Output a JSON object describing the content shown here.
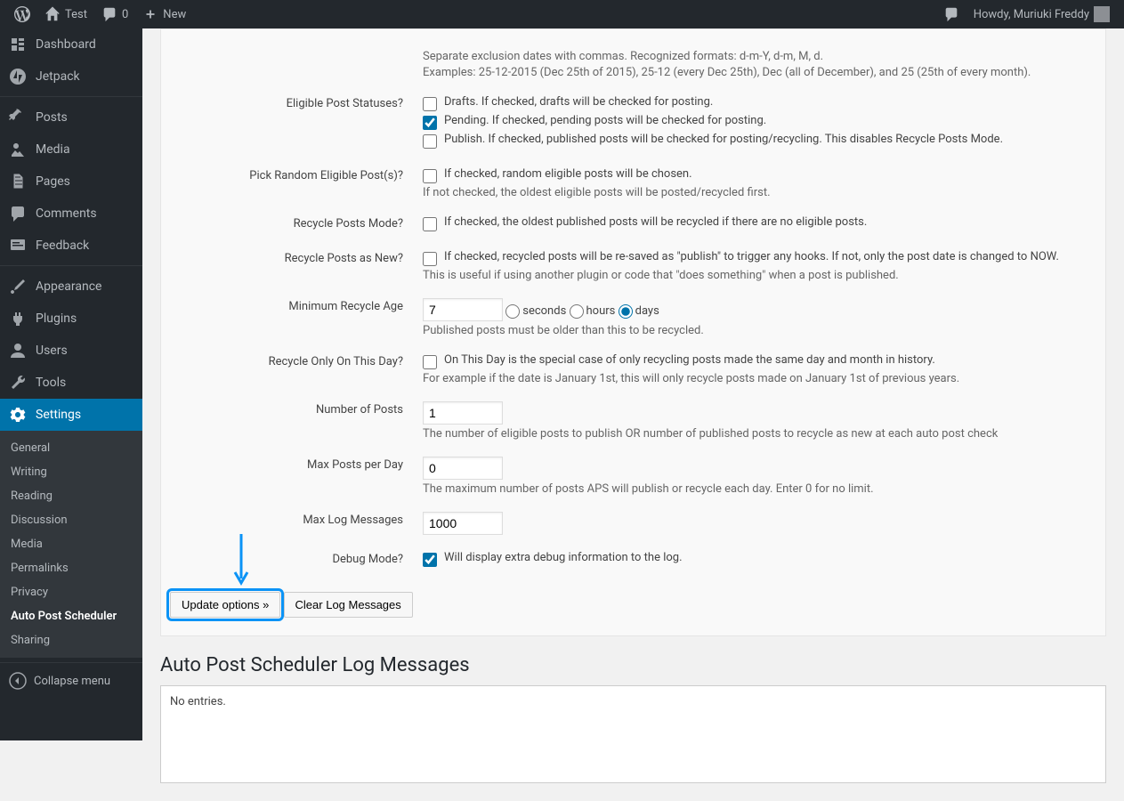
{
  "adminbar": {
    "site_name": "Test",
    "comments_count": "0",
    "new_label": "New",
    "howdy": "Howdy, Muriuki Freddy"
  },
  "sidebar": {
    "dashboard": "Dashboard",
    "jetpack": "Jetpack",
    "posts": "Posts",
    "media": "Media",
    "pages": "Pages",
    "comments": "Comments",
    "feedback": "Feedback",
    "appearance": "Appearance",
    "plugins": "Plugins",
    "users": "Users",
    "tools": "Tools",
    "settings": "Settings",
    "submenu": {
      "general": "General",
      "writing": "Writing",
      "reading": "Reading",
      "discussion": "Discussion",
      "media": "Media",
      "permalinks": "Permalinks",
      "privacy": "Privacy",
      "aps": "Auto Post Scheduler",
      "sharing": "Sharing"
    },
    "collapse": "Collapse menu"
  },
  "form": {
    "exclusion_help1": "Separate exclusion dates with commas. Recognized formats: d-m-Y, d-m, M, d.",
    "exclusion_help2": "Examples: 25-12-2015 (Dec 25th of 2015), 25-12 (every Dec 25th), Dec (all of December), and 25 (25th of every month).",
    "eligible_label": "Eligible Post Statuses?",
    "eligible_drafts": "Drafts. If checked, drafts will be checked for posting.",
    "eligible_pending": "Pending. If checked, pending posts will be checked for posting.",
    "eligible_publish": "Publish. If checked, published posts will be checked for posting/recycling. This disables Recycle Posts Mode.",
    "random_label": "Pick Random Eligible Post(s)?",
    "random_text": "If checked, random eligible posts will be chosen.",
    "random_desc": "If not checked, the oldest eligible posts will be posted/recycled first.",
    "recycle_mode_label": "Recycle Posts Mode?",
    "recycle_mode_text": "If checked, the oldest published posts will be recycled if there are no eligible posts.",
    "recycle_new_label": "Recycle Posts as New?",
    "recycle_new_text": "If checked, recycled posts will be re-saved as \"publish\" to trigger any hooks. If not, only the post date is changed to NOW.",
    "recycle_new_desc": "This is useful if using another plugin or code that \"does something\" when a post is published.",
    "min_recycle_label": "Minimum Recycle Age",
    "min_recycle_value": "7",
    "unit_seconds": "seconds",
    "unit_hours": "hours",
    "unit_days": "days",
    "min_recycle_desc": "Published posts must be older than this to be recycled.",
    "recycle_day_label": "Recycle Only On This Day?",
    "recycle_day_text": "On This Day is the special case of only recycling posts made the same day and month in history.",
    "recycle_day_desc": "For example if the date is January 1st, this will only recycle posts made on January 1st of previous years.",
    "num_posts_label": "Number of Posts",
    "num_posts_value": "1",
    "num_posts_desc": "The number of eligible posts to publish OR number of published posts to recycle as new at each auto post check",
    "max_day_label": "Max Posts per Day",
    "max_day_value": "0",
    "max_day_desc": "The maximum number of posts APS will publish or recycle each day. Enter 0 for no limit.",
    "max_log_label": "Max Log Messages",
    "max_log_value": "1000",
    "debug_label": "Debug Mode?",
    "debug_text": "Will display extra debug information to the log.",
    "btn_update": "Update options »",
    "btn_clear": "Clear Log Messages"
  },
  "log": {
    "title": "Auto Post Scheduler Log Messages",
    "empty": "No entries."
  }
}
